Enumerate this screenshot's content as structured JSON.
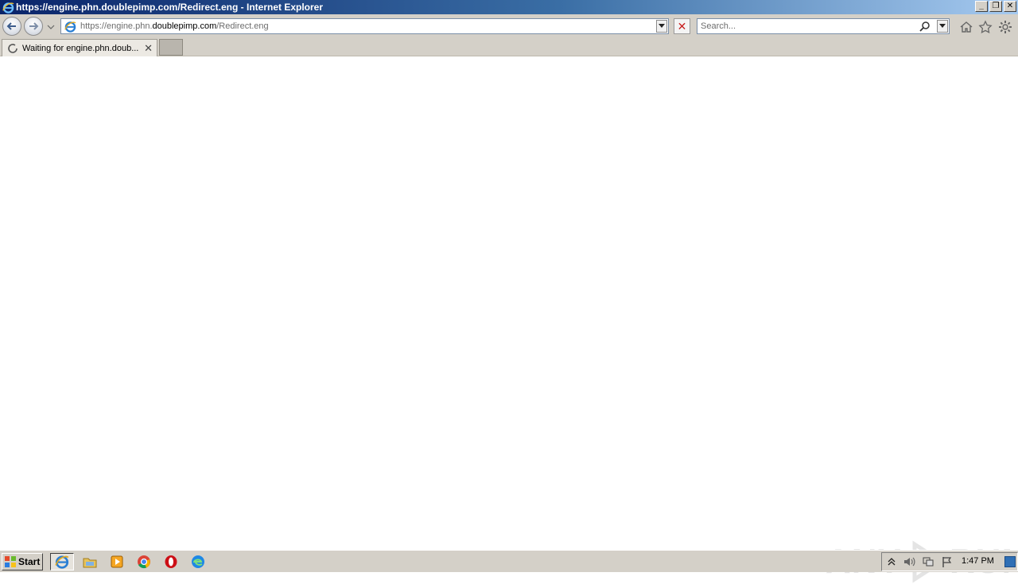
{
  "window": {
    "title": "https://engine.phn.doublepimp.com/Redirect.eng - Internet Explorer",
    "buttons": {
      "minimize": "_",
      "restore": "❐",
      "close": "✕"
    }
  },
  "navbar": {
    "address": {
      "prefix": "https://engine.phn.",
      "domain": "doublepimp.com",
      "suffix": "/Redirect.eng"
    },
    "search": {
      "placeholder": "Search..."
    },
    "stop_glyph": "✕"
  },
  "tabs": [
    {
      "title": "Waiting for engine.phn.doub...",
      "close": "✕",
      "loading": true
    }
  ],
  "watermark": {
    "text_left": "ANY",
    "text_right": "RUN"
  },
  "taskbar": {
    "start_label": "Start",
    "apps": [
      "internet-explorer",
      "file-explorer",
      "media-player",
      "chrome",
      "opera",
      "edge"
    ],
    "clock": "1:47 PM"
  },
  "colors": {
    "title_gradient_start": "#0a246a",
    "chrome_bg": "#d4d0c8",
    "stop_red": "#c81e1e"
  }
}
